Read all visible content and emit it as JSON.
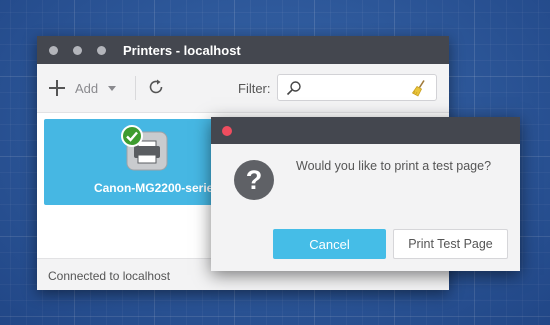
{
  "main_window": {
    "title": "Printers - localhost",
    "toolbar": {
      "add_label": "Add",
      "filter_label": "Filter:",
      "filter_value": ""
    },
    "printers": [
      {
        "name": "Canon-MG2200-series",
        "status_icon": "check-badge-icon"
      }
    ],
    "status_text": "Connected to localhost"
  },
  "dialog": {
    "message": "Would you like to print a test page?",
    "cancel_label": "Cancel",
    "print_label": "Print Test Page"
  },
  "colors": {
    "desktop": "#2c5ea6",
    "titlebar": "#44474f",
    "accent": "#46b7e3",
    "close": "#ef4d5f"
  }
}
